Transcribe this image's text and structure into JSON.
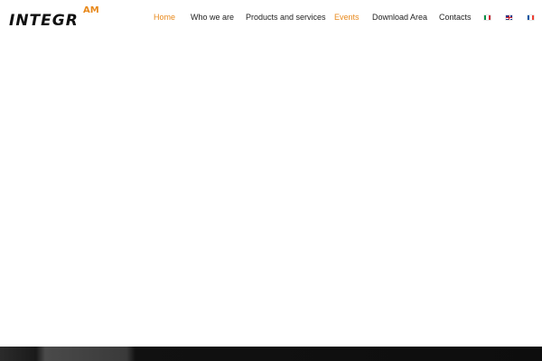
{
  "logo": {
    "main_text": "INTEGR",
    "superscript_text": "AM"
  },
  "nav": {
    "items": [
      {
        "label": "Home",
        "active": true
      },
      {
        "label": "Who we are",
        "active": false
      },
      {
        "label": "Products and services",
        "active": false
      },
      {
        "label": "Events",
        "active": true
      },
      {
        "label": "Download Area",
        "active": false
      },
      {
        "label": "Contacts",
        "active": false
      }
    ],
    "languages": [
      {
        "icon": "italy-flag-icon"
      },
      {
        "icon": "uk-flag-icon"
      },
      {
        "icon": "france-flag-icon"
      }
    ]
  },
  "colors": {
    "accent": "#e8891c",
    "text": "#222222",
    "background": "#ffffff",
    "footer": "#111111"
  }
}
